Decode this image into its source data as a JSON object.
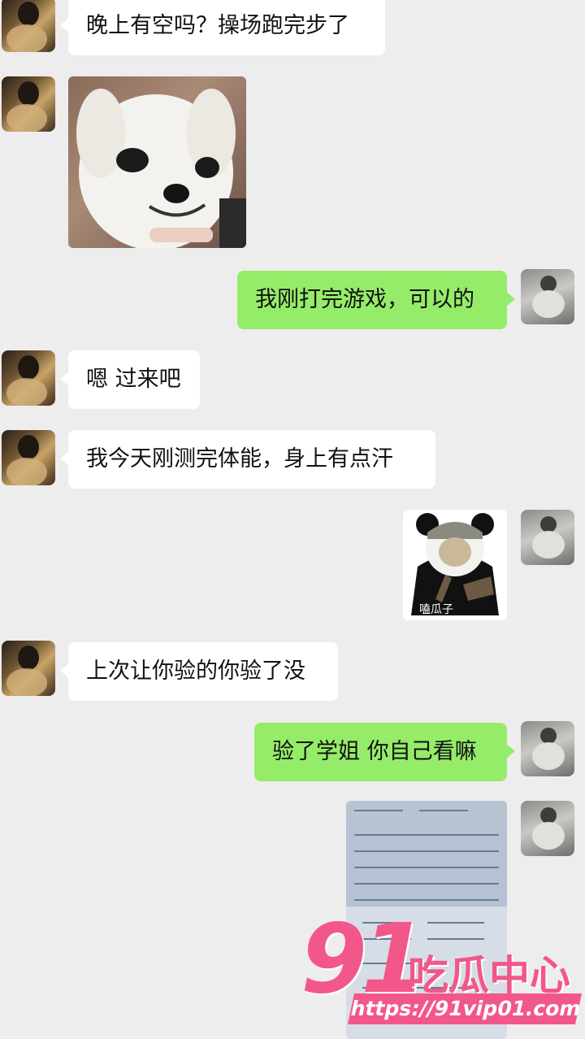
{
  "messages": [
    {
      "sender": "other",
      "text": "晚上有空吗？操场跑完步了"
    },
    {
      "sender": "other",
      "type": "image",
      "description_icon": "chihuahua-sticker"
    },
    {
      "sender": "me",
      "text": "我刚打完游戏，可以的"
    },
    {
      "sender": "other",
      "text": "嗯 过来吧"
    },
    {
      "sender": "other",
      "text": "我今天刚测完体能，身上有点汗"
    },
    {
      "sender": "me",
      "type": "image",
      "sticker_caption": "嗑瓜子"
    },
    {
      "sender": "other",
      "text": "上次让你验的你验了没"
    },
    {
      "sender": "me",
      "text": "验了学姐 你自己看嘛"
    },
    {
      "sender": "me",
      "type": "image",
      "description_icon": "report-photo"
    }
  ],
  "watermark": {
    "number": "91",
    "title": "吃瓜中心",
    "url": "https://91vip01.com"
  },
  "colors": {
    "background": "#ededed",
    "my_bubble": "#95ec69",
    "their_bubble": "#ffffff",
    "watermark": "#f2578a"
  }
}
